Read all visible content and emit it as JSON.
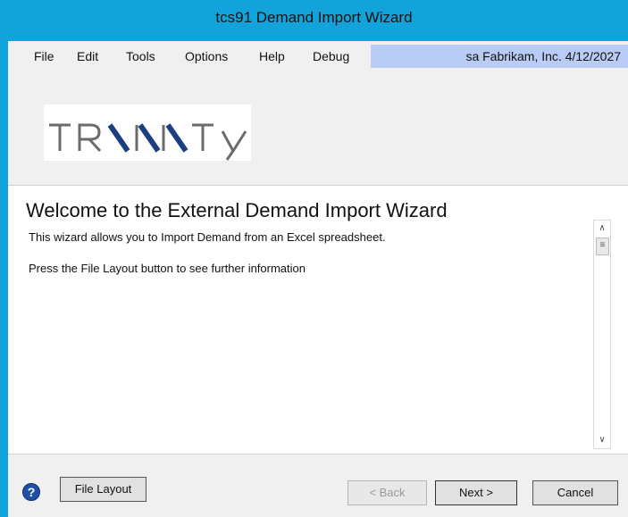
{
  "window": {
    "title": "tcs91 Demand Import Wizard"
  },
  "menu": {
    "items": [
      "File",
      "Edit",
      "Tools",
      "Options",
      "Help",
      "Debug"
    ],
    "session_info": "sa  Fabrikam, Inc.  4/12/2027"
  },
  "logo": {
    "text": "TRINITY"
  },
  "content": {
    "heading": "Welcome to the External Demand Import Wizard",
    "line1": "This wizard allows you to Import Demand from an Excel spreadsheet.",
    "line2": "Press the File Layout button to see further information"
  },
  "buttons": {
    "file_layout": "File Layout",
    "back": "< Back",
    "next": "Next >",
    "cancel": "Cancel"
  },
  "icons": {
    "help": "help-icon",
    "scroll_up": "chevron-up-icon",
    "scroll_down": "chevron-down-icon"
  }
}
